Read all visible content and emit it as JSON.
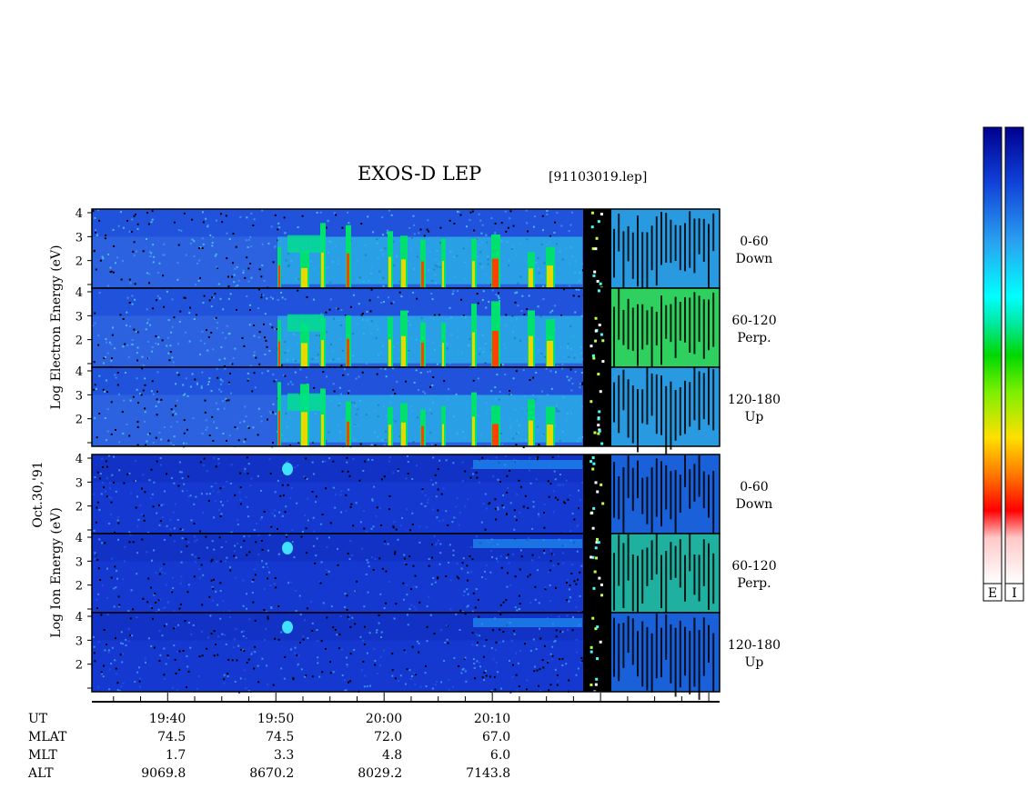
{
  "header": {
    "title": "EXOS-D LEP",
    "file": "[91103019.lep]"
  },
  "date_label": "Oct.30,'91",
  "chart_data": {
    "type": "heatmap",
    "title": "EXOS-D LEP",
    "x_axis": {
      "quantity": "UT",
      "ticks": [
        "19:40",
        "19:50",
        "20:00",
        "20:10"
      ]
    },
    "y_range": [
      1,
      4
    ],
    "y_ticks": [
      "4",
      "3",
      "2"
    ],
    "colorbars": [
      "E",
      "I"
    ],
    "groups": [
      {
        "ylabel": [
          "Log",
          "Electron",
          "Energy",
          "(eV)"
        ],
        "panels": [
          {
            "angle": "0-60",
            "direction": "Down"
          },
          {
            "angle": "60-120",
            "direction": "Perp."
          },
          {
            "angle": "120-180",
            "direction": "Up"
          }
        ]
      },
      {
        "ylabel": [
          "Log",
          "Ion",
          "Energy",
          "(eV)"
        ],
        "panels": [
          {
            "angle": "0-60",
            "direction": "Down"
          },
          {
            "angle": "60-120",
            "direction": "Perp."
          },
          {
            "angle": "120-180",
            "direction": "Up"
          }
        ]
      }
    ]
  },
  "footer": {
    "rows": [
      {
        "label": "UT",
        "values": [
          "19:40",
          "19:50",
          "20:00",
          "20:10"
        ]
      },
      {
        "label": "MLAT",
        "values": [
          "74.5",
          "74.5",
          "72.0",
          "67.0"
        ]
      },
      {
        "label": "MLT",
        "values": [
          "1.7",
          "3.3",
          "4.8",
          "6.0"
        ]
      },
      {
        "label": "ALT",
        "values": [
          "9069.8",
          "8670.2",
          "8029.2",
          "7143.8"
        ]
      }
    ]
  }
}
